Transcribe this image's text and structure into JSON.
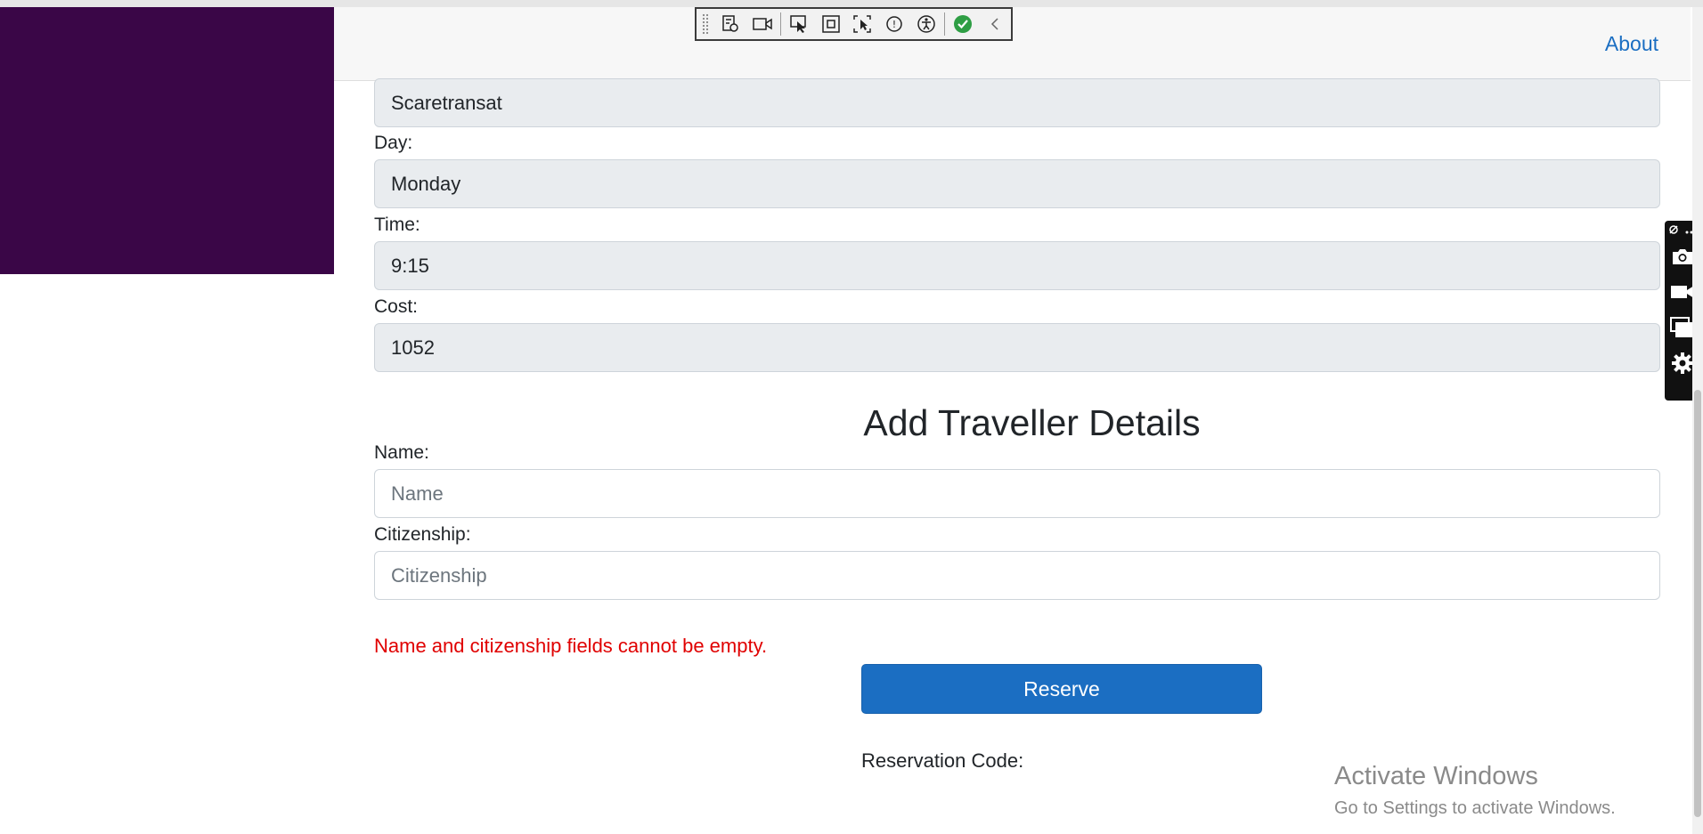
{
  "navbar": {
    "about_label": "About"
  },
  "devtools_toolbar": {
    "icons": [
      "visual-tree-icon",
      "video-icon",
      "select-element-icon",
      "display-layout-icon",
      "track-focus-icon",
      "binding-failures-icon",
      "accessibility-icon",
      "check-icon",
      "collapse-chevron-icon"
    ]
  },
  "trip": {
    "carrier_value": "Scaretransat",
    "day_label": "Day:",
    "day_value": "Monday",
    "time_label": "Time:",
    "time_value": "9:15",
    "cost_label": "Cost:",
    "cost_value": "1052"
  },
  "traveller": {
    "heading": "Add Traveller Details",
    "name_label": "Name:",
    "name_placeholder": "Name",
    "name_value": "",
    "citizenship_label": "Citizenship:",
    "citizenship_placeholder": "Citizenship",
    "citizenship_value": ""
  },
  "error_message": "Name and citizenship fields cannot be empty.",
  "reserve_label": "Reserve",
  "reservation_code_label": "Reservation Code:",
  "watermark": {
    "line1": "Activate Windows",
    "line2": "Go to Settings to activate Windows."
  },
  "capture_bar": {
    "icons": [
      "pin-icon",
      "more-icon",
      "camera-icon",
      "video-camera-icon",
      "window-icon",
      "settings-icon"
    ]
  },
  "colors": {
    "sidebar": "#3a0647",
    "accent": "#1b6ec2",
    "error": "#e00000",
    "readonly_field": "#e9ecef"
  }
}
